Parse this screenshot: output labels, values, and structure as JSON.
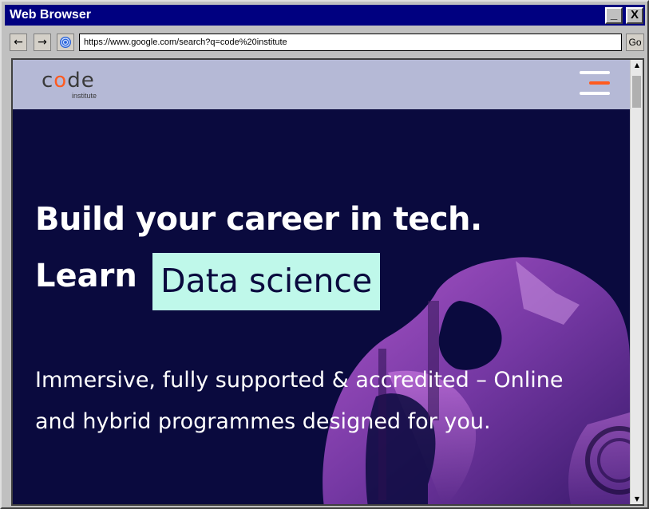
{
  "window": {
    "title": "Web Browser",
    "minimize_glyph": "_",
    "close_glyph": "X"
  },
  "nav": {
    "back_glyph": "←",
    "forward_glyph": "→",
    "home_icon": "browser-spiral-icon",
    "url": "https://www.google.com/search?q=code%20institute",
    "go_label": "Go"
  },
  "site": {
    "logo_word_before": "c",
    "logo_word_o": "o",
    "logo_word_after": "de",
    "logo_sub": "institute",
    "menu_icon": "hamburger-menu-icon",
    "headline_1": "Build your career in tech.",
    "headline_2_prefix": "Learn",
    "headline_2_highlight": "Data science",
    "subheadline": "Immersive, fully supported  & accredited – Online and hybrid programmes designed for you."
  },
  "colors": {
    "title_bar": "#000080",
    "header_bg": "#b5b9d6",
    "hero_bg": "#0a0a3e",
    "highlight_bg": "#bff8ea",
    "accent_orange": "#ff5a1f"
  },
  "scrollbar": {
    "up_glyph": "▲",
    "down_glyph": "▼"
  }
}
